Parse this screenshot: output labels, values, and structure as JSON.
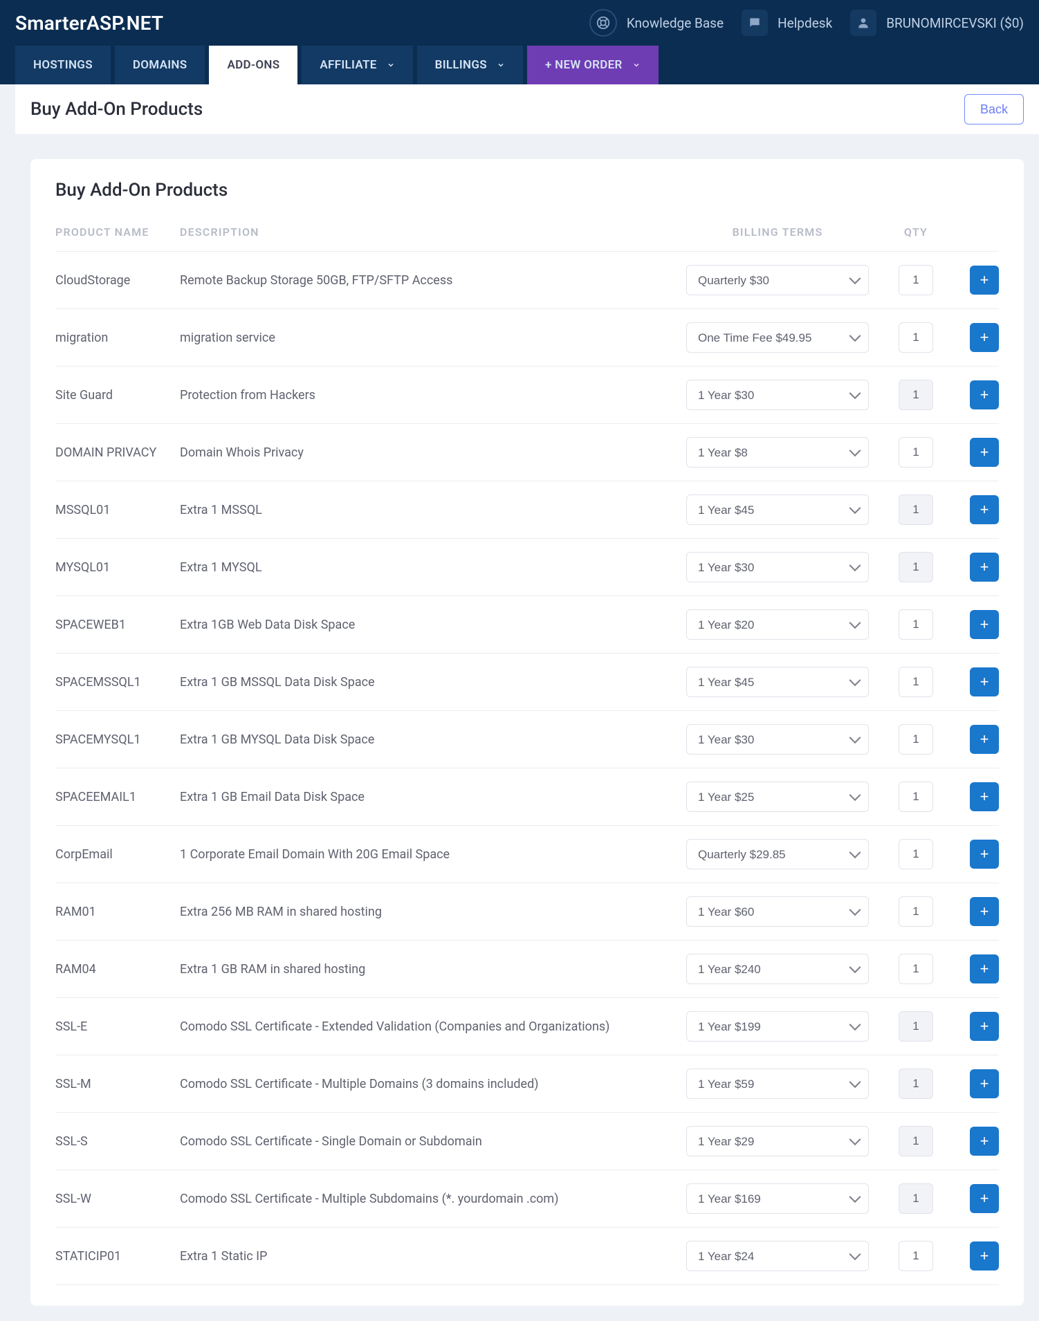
{
  "header": {
    "brand": "SmarterASP.NET",
    "kb": "Knowledge Base",
    "helpdesk": "Helpdesk",
    "user": "BRUNOMIRCEVSKI ($0)"
  },
  "tabs": {
    "hostings": "HOSTINGS",
    "domains": "DOMAINS",
    "addons": "ADD-ONS",
    "affiliate": "AFFILIATE",
    "billings": "BILLINGS",
    "neworder": "+ NEW ORDER"
  },
  "page": {
    "title": "Buy Add-On Products",
    "back": "Back",
    "card_title": "Buy Add-On Products"
  },
  "columns": {
    "name": "PRODUCT NAME",
    "desc": "DESCRIPTION",
    "billing": "BILLING TERMS",
    "qty": "QTY"
  },
  "rows": [
    {
      "name": "CloudStorage",
      "desc": "Remote Backup Storage 50GB, FTP/SFTP Access",
      "billing": "Quarterly  $30",
      "qty": "1",
      "locked": false
    },
    {
      "name": "migration",
      "desc": "migration service",
      "billing": "One Time Fee  $49.95",
      "qty": "1",
      "locked": false
    },
    {
      "name": "Site Guard",
      "desc": "Protection from Hackers",
      "billing": "1 Year  $30",
      "qty": "1",
      "locked": true
    },
    {
      "name": "DOMAIN PRIVACY",
      "desc": "Domain Whois Privacy",
      "billing": "1 Year  $8",
      "qty": "1",
      "locked": false
    },
    {
      "name": "MSSQL01",
      "desc": "Extra 1 MSSQL",
      "billing": "1 Year  $45",
      "qty": "1",
      "locked": true
    },
    {
      "name": "MYSQL01",
      "desc": "Extra 1 MYSQL",
      "billing": "1 Year  $30",
      "qty": "1",
      "locked": true
    },
    {
      "name": "SPACEWEB1",
      "desc": "Extra 1GB Web Data Disk Space",
      "billing": "1 Year  $20",
      "qty": "1",
      "locked": false
    },
    {
      "name": "SPACEMSSQL1",
      "desc": "Extra 1 GB MSSQL Data Disk Space",
      "billing": "1 Year  $45",
      "qty": "1",
      "locked": false
    },
    {
      "name": "SPACEMYSQL1",
      "desc": "Extra 1 GB MYSQL Data Disk Space",
      "billing": "1 Year  $30",
      "qty": "1",
      "locked": false
    },
    {
      "name": "SPACEEMAIL1",
      "desc": "Extra 1 GB Email Data Disk Space",
      "billing": "1 Year  $25",
      "qty": "1",
      "locked": false
    },
    {
      "name": "CorpEmail",
      "desc": "1 Corporate Email Domain With 20G Email Space",
      "billing": "Quarterly  $29.85",
      "qty": "1",
      "locked": false
    },
    {
      "name": "RAM01",
      "desc": "Extra 256 MB RAM in shared hosting",
      "billing": "1 Year  $60",
      "qty": "1",
      "locked": false
    },
    {
      "name": "RAM04",
      "desc": "Extra 1 GB RAM in shared hosting",
      "billing": "1 Year  $240",
      "qty": "1",
      "locked": false
    },
    {
      "name": "SSL-E",
      "desc": "Comodo SSL Certificate - Extended Validation (Companies and Organizations)",
      "billing": "1 Year  $199",
      "qty": "1",
      "locked": true
    },
    {
      "name": "SSL-M",
      "desc": "Comodo SSL Certificate - Multiple Domains (3 domains included)",
      "billing": "1 Year  $59",
      "qty": "1",
      "locked": true
    },
    {
      "name": "SSL-S",
      "desc": "Comodo SSL Certificate - Single Domain or Subdomain",
      "billing": "1 Year  $29",
      "qty": "1",
      "locked": true
    },
    {
      "name": "SSL-W",
      "desc": "Comodo SSL Certificate - Multiple Subdomains (*. yourdomain .com)",
      "billing": "1 Year  $169",
      "qty": "1",
      "locked": true
    },
    {
      "name": "STATICIP01",
      "desc": "Extra 1 Static IP",
      "billing": "1 Year  $24",
      "qty": "1",
      "locked": false
    }
  ]
}
